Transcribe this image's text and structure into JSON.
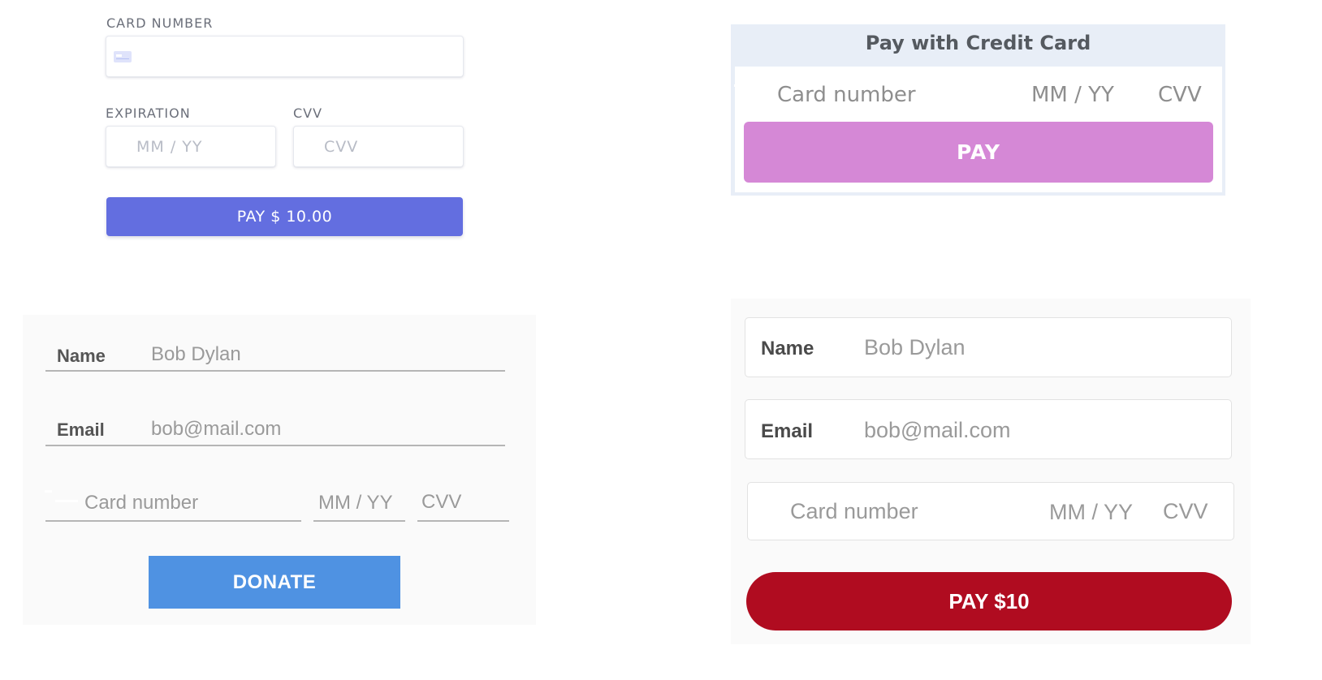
{
  "form_basic": {
    "card_number_label": "CARD NUMBER",
    "expiration_label": "EXPIRATION",
    "cvv_label": "CVV",
    "expiration_placeholder": "MM / YY",
    "cvv_placeholder": "CVV",
    "pay_button_label": "PAY $ 10.00",
    "accent_color": "#636ee0"
  },
  "form_credit_card": {
    "title": "Pay with Credit Card",
    "card_number_placeholder": "Card number",
    "expiration_placeholder": "MM / YY",
    "cvv_placeholder": "CVV",
    "pay_button_label": "PAY",
    "accent_color": "#d588d6"
  },
  "form_donate": {
    "name_label": "Name",
    "name_value": "Bob Dylan",
    "email_label": "Email",
    "email_value": "bob@mail.com",
    "card_number_placeholder": "Card number",
    "expiration_placeholder": "MM / YY",
    "cvv_placeholder": "CVV",
    "donate_button_label": "DONATE",
    "accent_color": "#4f92e2"
  },
  "form_pay": {
    "name_label": "Name",
    "name_value": "Bob Dylan",
    "email_label": "Email",
    "email_value": "bob@mail.com",
    "card_number_placeholder": "Card number",
    "expiration_placeholder": "MM / YY",
    "cvv_placeholder": "CVV",
    "pay_button_label": "PAY $10",
    "accent_color": "#b00c20"
  },
  "icons": {
    "card": "credit-card-icon"
  }
}
